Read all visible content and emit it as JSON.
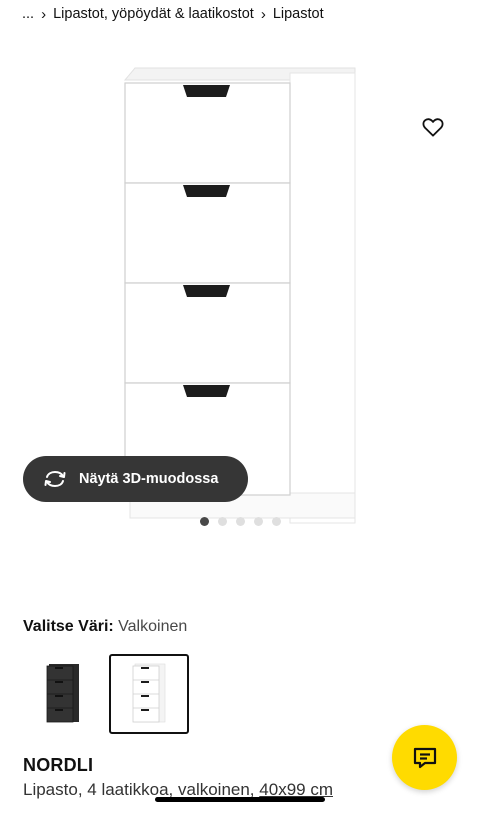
{
  "breadcrumb": {
    "ellipsis": "...",
    "items": [
      {
        "label": "Lipastot, yöpöydät & laatikostot"
      },
      {
        "label": "Lipastot"
      }
    ]
  },
  "gallery": {
    "view_3d_label": "Näytä 3D-muodossa",
    "dot_count": 5,
    "active_dot": 0
  },
  "colors": {
    "label": "Valitse Väri:",
    "selected": "Valkoinen",
    "options": [
      {
        "swatch": "black"
      },
      {
        "swatch": "white"
      }
    ]
  },
  "product": {
    "name": "NORDLI",
    "description": "Lipasto, 4 laatikkoa, valkoinen,",
    "measure": "40x99 cm"
  },
  "theme": {
    "accent": "#ffdb00",
    "dark_button": "#363636",
    "drawer_handle": "#1c1c1c",
    "cabinet_white": "#ffffff",
    "cabinet_black": "#2a2a2a"
  }
}
